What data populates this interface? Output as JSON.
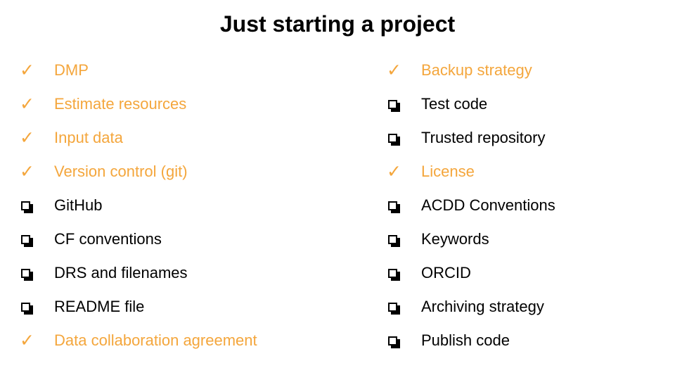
{
  "title": "Just starting a project",
  "colors": {
    "done": "#f4a63c",
    "todo": "#000000"
  },
  "left_items": [
    {
      "label": "DMP",
      "done": true
    },
    {
      "label": "Estimate resources",
      "done": true
    },
    {
      "label": "Input data",
      "done": true
    },
    {
      "label": "Version control (git)",
      "done": true
    },
    {
      "label": "GitHub",
      "done": false
    },
    {
      "label": "CF conventions",
      "done": false
    },
    {
      "label": "DRS and filenames",
      "done": false
    },
    {
      "label": "README file",
      "done": false
    },
    {
      "label": "Data collaboration agreement",
      "done": true
    }
  ],
  "right_items": [
    {
      "label": "Backup strategy",
      "done": true
    },
    {
      "label": "Test code",
      "done": false
    },
    {
      "label": "Trusted repository",
      "done": false
    },
    {
      "label": "License",
      "done": true
    },
    {
      "label": "ACDD Conventions",
      "done": false
    },
    {
      "label": "Keywords",
      "done": false
    },
    {
      "label": "ORCID",
      "done": false
    },
    {
      "label": "Archiving strategy",
      "done": false
    },
    {
      "label": "Publish code",
      "done": false
    }
  ]
}
